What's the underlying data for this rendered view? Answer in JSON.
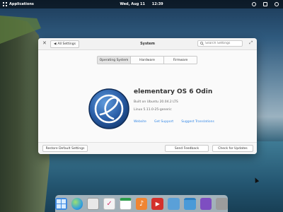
{
  "panel": {
    "applications_label": "Applications",
    "date": "Wed, Aug 11",
    "time": "12:39"
  },
  "window": {
    "title": "System",
    "back_label": "All Settings",
    "search_placeholder": "Search Settings",
    "tabs": [
      {
        "label": "Operating System",
        "active": true
      },
      {
        "label": "Hardware",
        "active": false
      },
      {
        "label": "Firmware",
        "active": false
      }
    ],
    "os_name": "elementary OS 6 Odin",
    "build_info": "Built on Ubuntu 20.04.2 LTS",
    "kernel": "Linux 5.11.0-25-generic",
    "links": [
      "Website",
      "Get Support",
      "Suggest Translations"
    ],
    "buttons": {
      "restore": "Restore Default Settings",
      "feedback": "Send Feedback",
      "update": "Check for Updates"
    }
  },
  "dock": {
    "apps": [
      "multitasking-view",
      "web-browser",
      "mail",
      "tasks",
      "calendar",
      "music",
      "videos",
      "photos",
      "files",
      "appcenter",
      "system-settings"
    ]
  },
  "colors": {
    "link": "#3689e6",
    "panel": "#000000"
  }
}
